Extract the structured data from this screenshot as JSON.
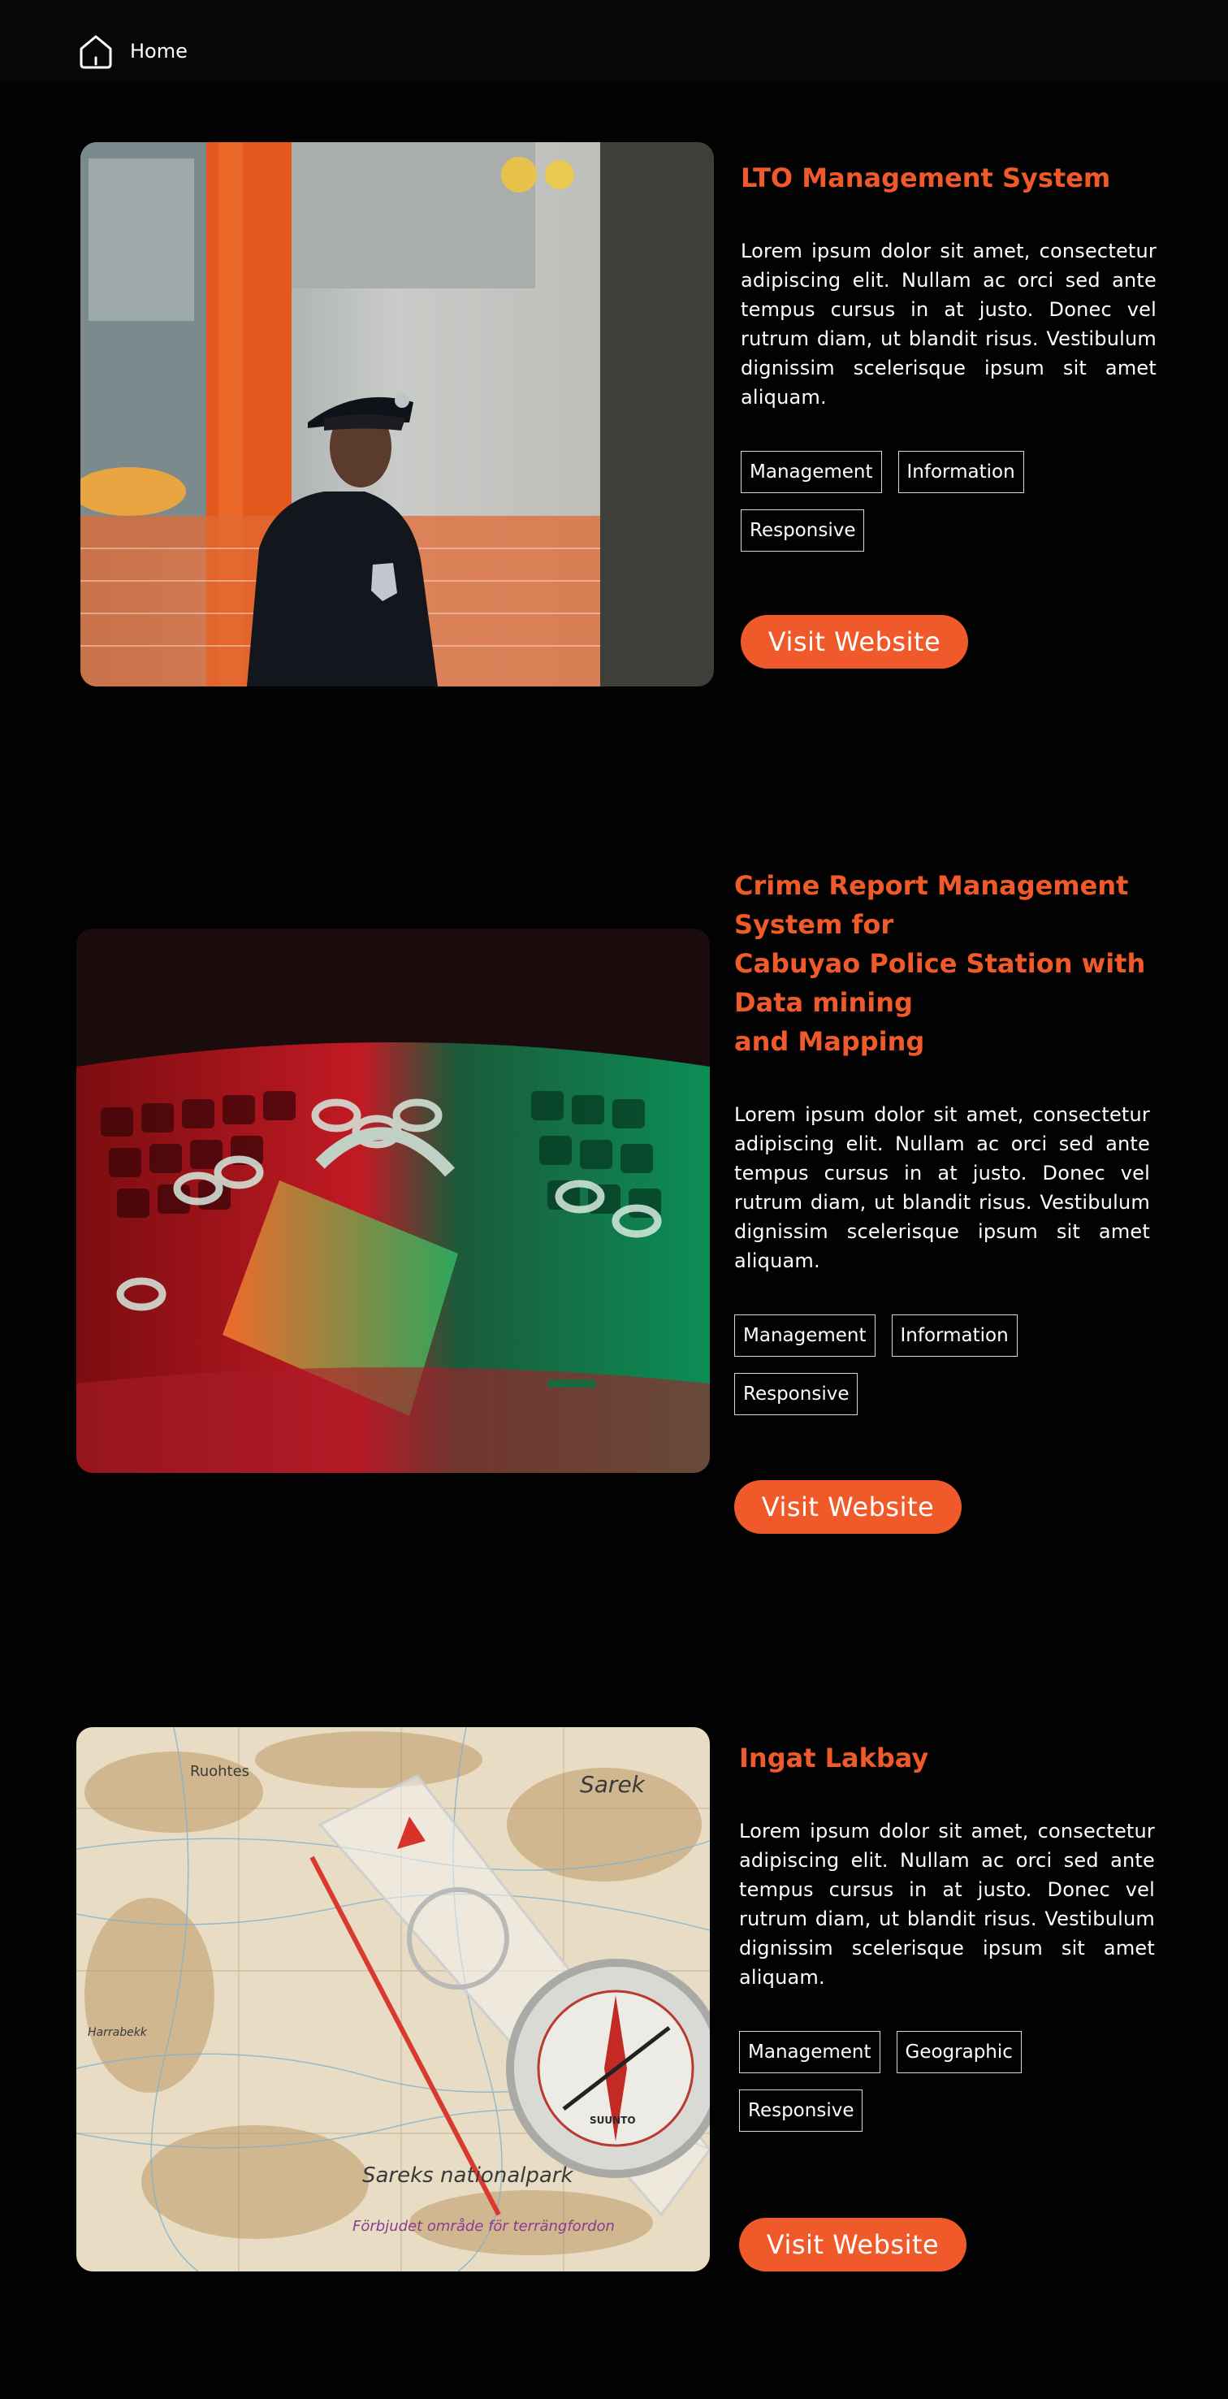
{
  "nav": {
    "home_label": "Home",
    "home_icon": "home-icon"
  },
  "colors": {
    "accent": "#f05a2a",
    "background": "#020202",
    "topbar": "#070707",
    "tag_border": "#d8d8d8"
  },
  "projects": [
    {
      "title": "LTO Management System",
      "description": "Lorem ipsum dolor sit amet, consectetur adipiscing elit. Nullam ac orci sed ante tempus cursus in at justo. Donec vel rutrum diam, ut blandit risus. Vestibulum dignissim scelerisque ipsum sit amet aliquam.",
      "tags": [
        "Management",
        "Information",
        "Responsive"
      ],
      "button_label": "Visit Website",
      "image": "police-officer-photo"
    },
    {
      "title": "Crime Report Management\nSystem for\nCabuyao Police Station with\nData mining\nand Mapping",
      "description": "Lorem ipsum dolor sit amet, consectetur adipiscing elit. Nullam ac orci sed ante tempus cursus in at justo. Donec vel rutrum diam, ut blandit risus. Vestibulum dignissim scelerisque ipsum sit amet aliquam.",
      "tags": [
        "Management",
        "Information",
        "Responsive"
      ],
      "button_label": "Visit Website",
      "image": "padlock-chain-keyboard-photo"
    },
    {
      "title": "Ingat Lakbay",
      "description": "Lorem ipsum dolor sit amet, consectetur adipiscing elit. Nullam ac orci sed ante tempus cursus in at justo. Donec vel rutrum diam, ut blandit risus. Vestibulum dignissim scelerisque ipsum sit amet aliquam.",
      "tags": [
        "Management",
        "Geographic",
        "Responsive"
      ],
      "button_label": "Visit Website",
      "image": "compass-on-map-photo",
      "map_labels": [
        "Sarek",
        "Sareks nationalpark",
        "Förbjudet område för terrängfordon",
        "Ruohtes",
        "Harrabekk",
        "SUUNTO"
      ]
    }
  ]
}
